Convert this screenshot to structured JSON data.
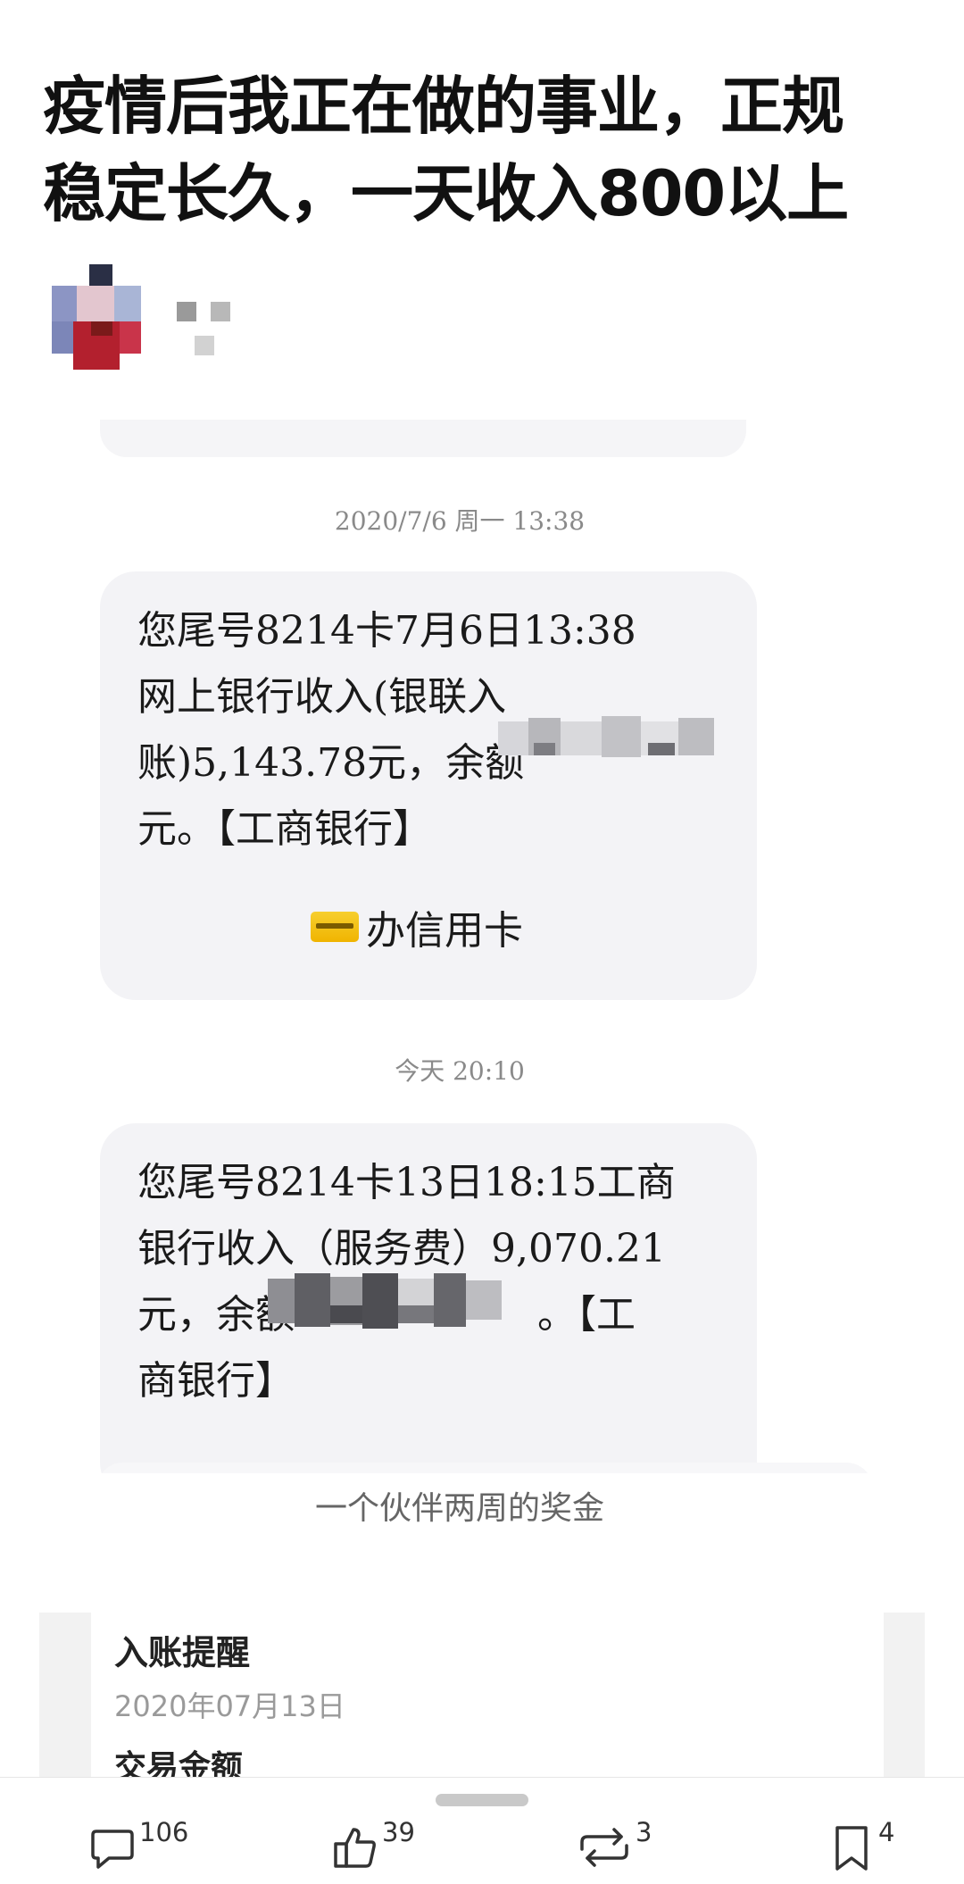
{
  "post": {
    "headline_line1": "疫情后我正在做的事业，正规",
    "headline_line2": "稳定长久，一天收入800以上"
  },
  "sms_screenshot": {
    "timestamp_1": "2020/7/6 周一 13:38",
    "message_1": {
      "line1": "您尾号8214卡7月6日13:38",
      "line2": "网上银行收入(银联入",
      "line3": "账)5,143.78元，余额",
      "line4": "元。【工商银行】"
    },
    "credit_card_link": "办信用卡",
    "timestamp_2": "今天 20:10",
    "message_2": {
      "line1": "您尾号8214卡13日18:15工商",
      "line2": "银行收入（服务费）9,070.21",
      "line3": "元，余额",
      "line3_end": "。【工",
      "line4": "商银行】"
    }
  },
  "caption": "一个伙伴两周的奖金",
  "notice_screenshot": {
    "title": "入账提醒",
    "date": "2020年07月13日",
    "field_label": "交易金额"
  },
  "actions": {
    "comments": "106",
    "likes": "39",
    "reposts": "3",
    "bookmarks": "4"
  },
  "colors": {
    "bubble": "#f3f3f6",
    "timestamp": "#8a8a8a",
    "card_icon": "#f0b400"
  }
}
